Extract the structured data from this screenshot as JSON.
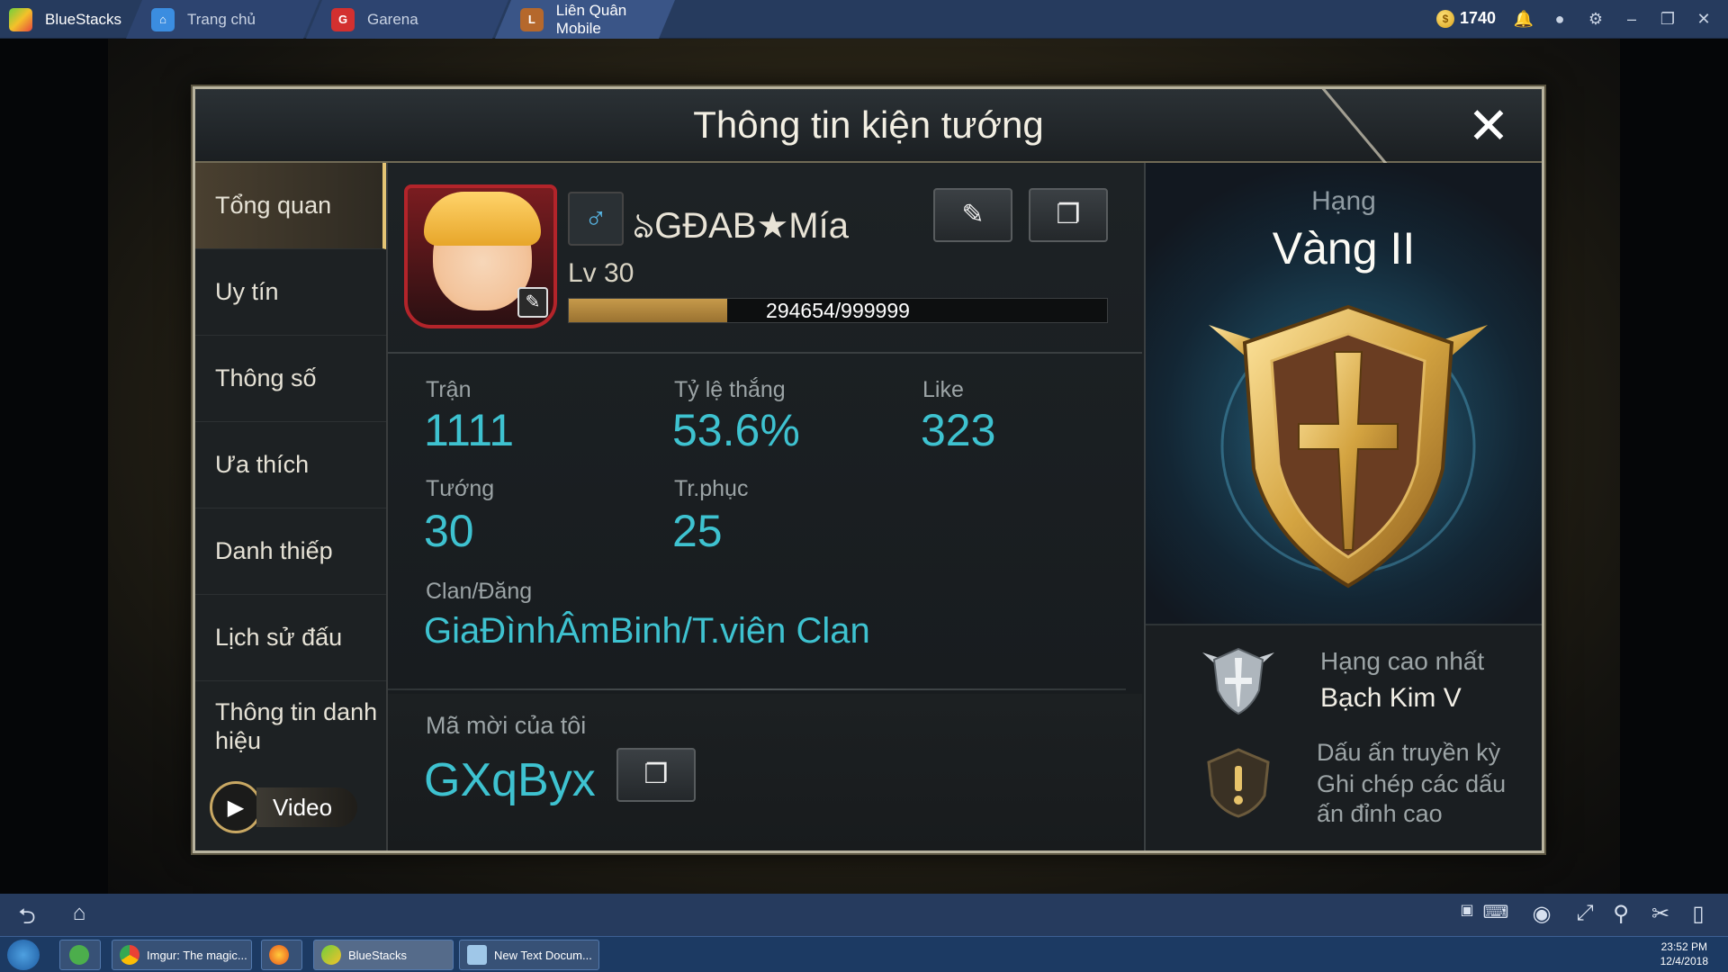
{
  "window": {
    "app_name": "BlueStacks",
    "tabs": [
      {
        "label": "Trang chủ"
      },
      {
        "label": "Garena"
      },
      {
        "label": "Liên Quân Mobile"
      }
    ],
    "coins": "1740"
  },
  "panel": {
    "title": "Thông tin kiện tướng",
    "close": "✕"
  },
  "sidebar": {
    "items": [
      {
        "label": "Tổng quan"
      },
      {
        "label": "Uy tín"
      },
      {
        "label": "Thông số"
      },
      {
        "label": "Ưa thích"
      },
      {
        "label": "Danh thiếp"
      },
      {
        "label": "Lịch sử đấu"
      },
      {
        "label": "Thông tin danh hiệu"
      }
    ],
    "video_label": "Video"
  },
  "profile": {
    "gender_symbol": "♂",
    "name": "ঌGĐAB★Mía",
    "level": "Lv 30",
    "xp_text": "294654/999999",
    "xp_fraction": 0.2946
  },
  "stats": {
    "matches_label": "Trận",
    "matches_value": "1111",
    "winrate_label": "Tỷ lệ thắng",
    "winrate_value": "53.6%",
    "like_label": "Like",
    "like_value": "323",
    "heroes_label": "Tướng",
    "heroes_value": "30",
    "skins_label": "Tr.phục",
    "skins_value": "25",
    "clan_label": "Clan/Đăng",
    "clan_value": "GiaĐìnhÂmBinh/T.viên Clan"
  },
  "invite": {
    "label": "Mã mời của tôi",
    "code": "GXqByx"
  },
  "rank": {
    "label": "Hạng",
    "name": "Vàng II",
    "best_label": "Hạng cao nhất",
    "best_value": "Bạch Kim V",
    "legacy_title": "Dấu ấn truyền kỳ",
    "legacy_desc": "Ghi chép các dấu ấn đỉnh cao"
  },
  "taskbar": {
    "tasks": [
      {
        "label": "Imgur: The magic..."
      },
      {
        "label": "BlueStacks"
      },
      {
        "label": "New Text Docum..."
      }
    ],
    "time": "23:52 PM",
    "date": "12/4/2018"
  },
  "colors": {
    "accent_cyan": "#3ec2d0",
    "gold": "#e4c474",
    "bluestacks_bar": "#263b5e"
  }
}
